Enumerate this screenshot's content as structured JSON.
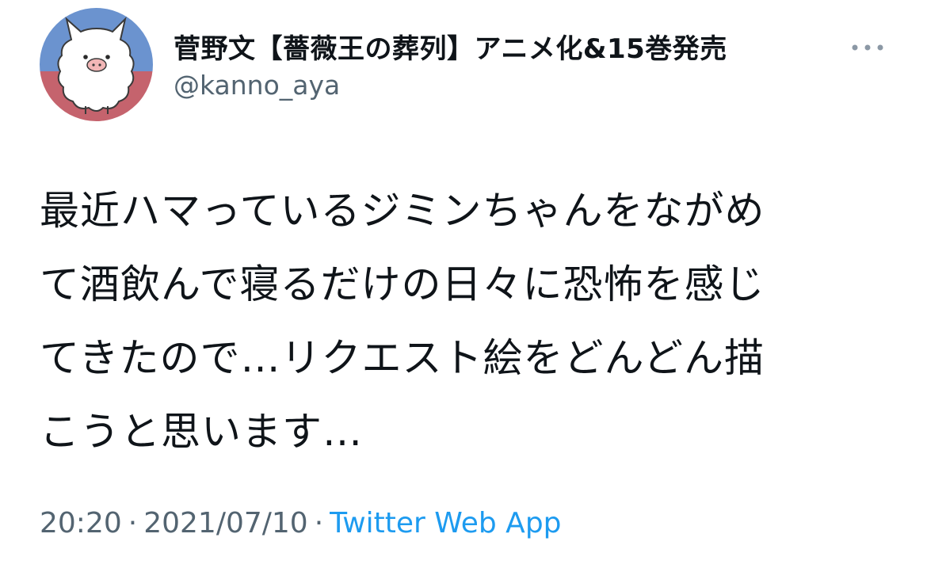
{
  "author": {
    "display_name": "菅野文【薔薇王の葬列】アニメ化&15巻発売",
    "handle": "@kanno_aya",
    "avatar_icon": "sheep-alpaca-avatar-icon"
  },
  "more_icon": "more-dots-icon",
  "tweet": {
    "lines": [
      "最近ハマっているジミンちゃんをながめ",
      "て酒飲んで寝るだけの日々に恐怖を感じ",
      "てきたので…リクエスト絵をどんどん描",
      "こうと思います…"
    ]
  },
  "meta": {
    "time": "20:20",
    "separator": "·",
    "date": "2021/07/10",
    "source": "Twitter Web App"
  },
  "colors": {
    "text": "#0f1419",
    "secondary": "#536471",
    "link": "#1d9bf0",
    "avatar_bg_top": "#6b93cf",
    "avatar_bg_bottom": "#c5636d"
  }
}
